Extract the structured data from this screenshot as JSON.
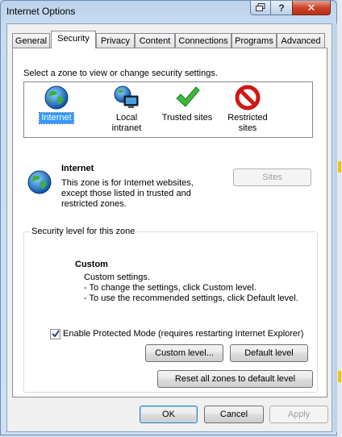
{
  "window": {
    "title": "Internet Options",
    "controls": {
      "restore_icon": "restore-icon",
      "help_label": "?",
      "close_label": "✕"
    }
  },
  "tabs": [
    {
      "label": "General",
      "active": false
    },
    {
      "label": "Security",
      "active": true
    },
    {
      "label": "Privacy",
      "active": false
    },
    {
      "label": "Content",
      "active": false
    },
    {
      "label": "Connections",
      "active": false
    },
    {
      "label": "Programs",
      "active": false
    },
    {
      "label": "Advanced",
      "active": false
    }
  ],
  "security": {
    "zone_prompt": "Select a zone to view or change security settings.",
    "zones": [
      {
        "label": "Internet",
        "icon": "globe-icon",
        "selected": true
      },
      {
        "label": "Local intranet",
        "icon": "intranet-icon",
        "selected": false
      },
      {
        "label": "Trusted sites",
        "icon": "checkmark-icon",
        "selected": false
      },
      {
        "label": "Restricted sites",
        "icon": "prohibited-icon",
        "selected": false
      }
    ],
    "selected_zone": {
      "name": "Internet",
      "description": "This zone is for Internet websites, except those listed in trusted and restricted zones.",
      "desc_lines": [
        "This zone is for Internet websites,",
        "except those listed in trusted and",
        "restricted zones."
      ]
    },
    "sites_button": "Sites",
    "level_group": {
      "title": "Security level for this zone",
      "level_name": "Custom",
      "lines": [
        "Custom settings.",
        "- To change the settings, click Custom level.",
        "- To use the recommended settings, click Default level."
      ]
    },
    "protected_mode": {
      "label": "Enable Protected Mode (requires restarting Internet Explorer)",
      "checked": true
    },
    "custom_level_button": "Custom level...",
    "default_level_button": "Default level",
    "reset_button": "Reset all zones to default level"
  },
  "footer": {
    "ok": "OK",
    "cancel": "Cancel",
    "apply": "Apply"
  },
  "colors": {
    "selection": "#3399ff",
    "close_button": "#c8452b",
    "title_bar": "#bcd3ec"
  }
}
